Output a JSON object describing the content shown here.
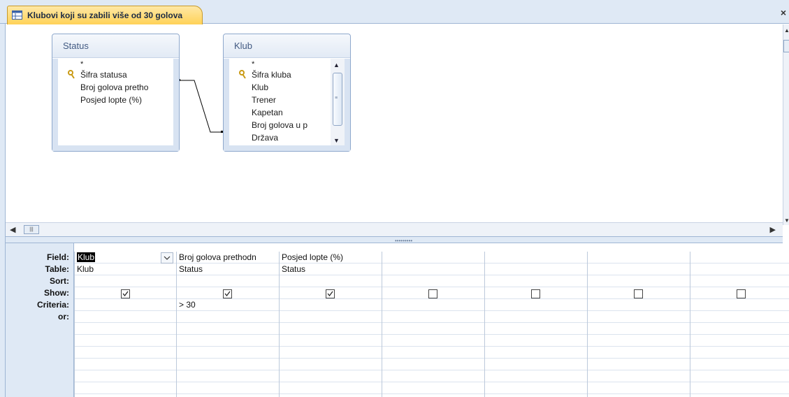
{
  "window": {
    "tab_title": "Klubovi koji su zabili više od 30 golova",
    "close_glyph": "×"
  },
  "tables": {
    "status": {
      "title": "Status",
      "fields": [
        "*",
        "Šifra statusa",
        "Broj golova pretho",
        "Posjed lopte (%)"
      ]
    },
    "klub": {
      "title": "Klub",
      "fields": [
        "*",
        "Šifra kluba",
        "Klub",
        "Trener",
        "Kapetan",
        "Broj golova u p",
        "Država"
      ]
    }
  },
  "grid": {
    "row_labels": [
      "Field:",
      "Table:",
      "Sort:",
      "Show:",
      "Criteria:",
      "or:"
    ],
    "columns": [
      {
        "field": "Klub",
        "table": "Klub",
        "sort": "",
        "show": true,
        "criteria": ""
      },
      {
        "field": "Broj golova prethodn",
        "table": "Status",
        "sort": "",
        "show": true,
        "criteria": "> 30"
      },
      {
        "field": "Posjed lopte (%)",
        "table": "Status",
        "sort": "",
        "show": true,
        "criteria": ""
      },
      {
        "field": "",
        "table": "",
        "sort": "",
        "show": false,
        "criteria": ""
      },
      {
        "field": "",
        "table": "",
        "sort": "",
        "show": false,
        "criteria": ""
      },
      {
        "field": "",
        "table": "",
        "sort": "",
        "show": false,
        "criteria": ""
      },
      {
        "field": "",
        "table": "",
        "sort": "",
        "show": false,
        "criteria": ""
      }
    ]
  },
  "icons": {
    "tab": "query-icon",
    "key": "primary-key-icon",
    "checkbox": "checkbox-icon",
    "dropdown": "chevron-down-icon"
  },
  "colors": {
    "tab_bg": "#ffd257",
    "chrome": "#dfe9f5",
    "border": "#9fb6d4"
  }
}
